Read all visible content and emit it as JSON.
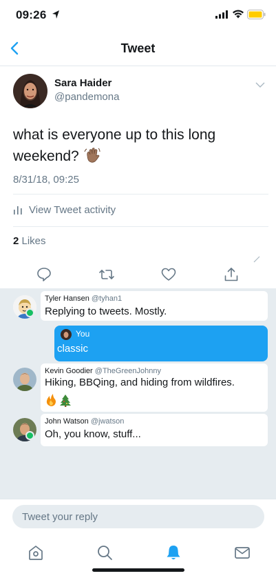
{
  "status_bar": {
    "time": "09:26"
  },
  "nav": {
    "title": "Tweet",
    "back_icon": "chevron-left-icon"
  },
  "tweet": {
    "author_name": "Sara Haider",
    "author_handle": "@pandemona",
    "text": "what is everyone up to this long weekend?",
    "emoji": "waving-hand-emoji",
    "date": "8/31/18, 09:25",
    "activity_label": "View Tweet activity",
    "likes_count": "2",
    "likes_label": " Likes"
  },
  "actions": [
    {
      "name": "reply-icon"
    },
    {
      "name": "retweet-icon"
    },
    {
      "name": "like-icon"
    },
    {
      "name": "share-icon"
    }
  ],
  "conversation": {
    "messages": [
      {
        "name": "Tyler Hansen",
        "handle": "@tyhan1",
        "text": "Replying to tweets. Mostly.",
        "online": true
      },
      {
        "name": "You",
        "text": "classic",
        "own": true
      },
      {
        "name": "Kevin Goodier",
        "handle": "@TheGreenJohnny",
        "text": "Hiking, BBQing, and hiding from wildfires.",
        "emoji": [
          "fire-emoji",
          "tree-emoji"
        ],
        "online": false
      },
      {
        "name": "John Watson",
        "handle": "@jwatson",
        "text": "Oh, you know, stuff...",
        "online": true
      }
    ]
  },
  "composer": {
    "placeholder": "Tweet your reply"
  },
  "tabs": [
    {
      "name": "home-icon"
    },
    {
      "name": "search-icon"
    },
    {
      "name": "notifications-icon",
      "active": true
    },
    {
      "name": "messages-icon"
    }
  ],
  "colors": {
    "accent": "#1da1f2",
    "text": "#14171a",
    "secondary": "#657786",
    "panel": "#e6ecf0",
    "online": "#17bf63"
  }
}
